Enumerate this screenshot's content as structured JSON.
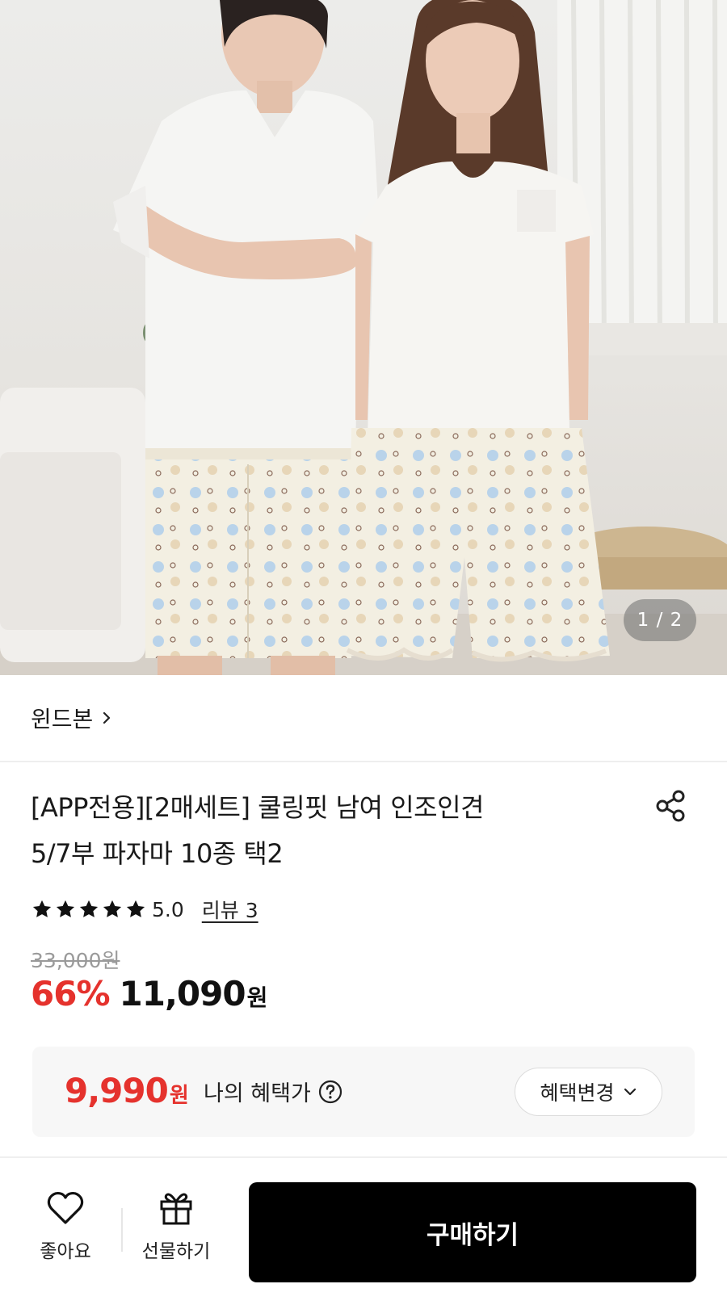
{
  "gallery": {
    "image_alt": "",
    "counter": "1 / 2"
  },
  "brand": {
    "name": "윈드본",
    "chevron_icon": "chevron-right-icon"
  },
  "product": {
    "title_line1": "[APP전용][2매세트] 쿨링핏 남여 인조인견",
    "title_line2": "5/7부 파자마 10종 택2",
    "share_icon": "share-icon"
  },
  "rating": {
    "stars": 5,
    "value": "5.0",
    "review_link": "리뷰 3"
  },
  "price": {
    "original": "33,000원",
    "discount": "66%",
    "sale": "11,090",
    "sale_unit": "원"
  },
  "benefit": {
    "price": "9,990",
    "price_unit": "원",
    "label": "나의 혜택가",
    "help_icon": "question-circle-icon",
    "change_button": "혜택변경",
    "change_icon": "chevron-down-icon"
  },
  "bottom_bar": {
    "like_label": "좋아요",
    "like_icon": "heart-icon",
    "gift_label": "선물하기",
    "gift_icon": "gift-icon",
    "buy_label": "구매하기"
  },
  "colors": {
    "accent_red": "#e5322d",
    "buy_button": "#000000",
    "benefit_bg": "#f7f7f7"
  }
}
